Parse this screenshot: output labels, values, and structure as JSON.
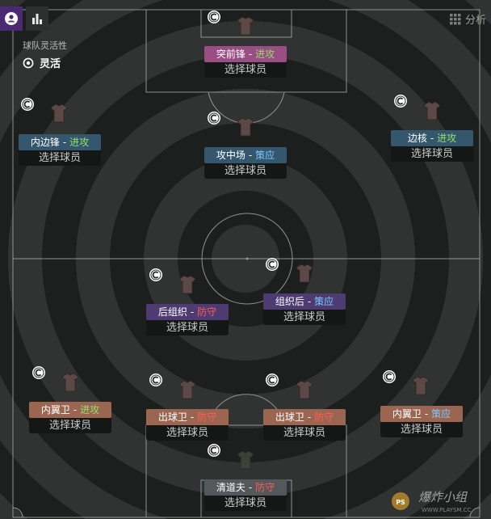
{
  "header": {
    "analysis_label": "分析"
  },
  "team_flex": {
    "label": "球队灵活性",
    "value": "灵活"
  },
  "select_label": "选择球员",
  "positions": [
    {
      "id": "striker",
      "role": "突前锋",
      "duty": "进攻",
      "duty_type": "attack",
      "color": "pink"
    },
    {
      "id": "inside-forward-left",
      "role": "内边锋",
      "duty": "进攻",
      "duty_type": "attack",
      "color": "blue"
    },
    {
      "id": "attacking-midfielder",
      "role": "攻中场",
      "duty": "策应",
      "duty_type": "support",
      "color": "blue"
    },
    {
      "id": "wing-back-right-attack",
      "role": "边核",
      "duty": "进攻",
      "duty_type": "attack",
      "color": "blue"
    },
    {
      "id": "deep-playmaker",
      "role": "后组织",
      "duty": "防守",
      "duty_type": "defend",
      "color": "purple"
    },
    {
      "id": "regista",
      "role": "组织后",
      "duty": "策应",
      "duty_type": "support",
      "color": "purple"
    },
    {
      "id": "inverted-wingback-left",
      "role": "内翼卫",
      "duty": "进攻",
      "duty_type": "attack",
      "color": "brown"
    },
    {
      "id": "ball-playing-defender-left",
      "role": "出球卫",
      "duty": "防守",
      "duty_type": "defend",
      "color": "brown"
    },
    {
      "id": "ball-playing-defender-right",
      "role": "出球卫",
      "duty": "防守",
      "duty_type": "defend",
      "color": "brown"
    },
    {
      "id": "inverted-wingback-right",
      "role": "内翼卫",
      "duty": "策应",
      "duty_type": "support",
      "color": "brown"
    },
    {
      "id": "sweeper-keeper",
      "role": "清道夫",
      "duty": "防守",
      "duty_type": "defend",
      "color": "gray"
    }
  ],
  "watermark": {
    "text": "爆炸小组",
    "subtext": "WWW.PLAYSM.CC"
  }
}
